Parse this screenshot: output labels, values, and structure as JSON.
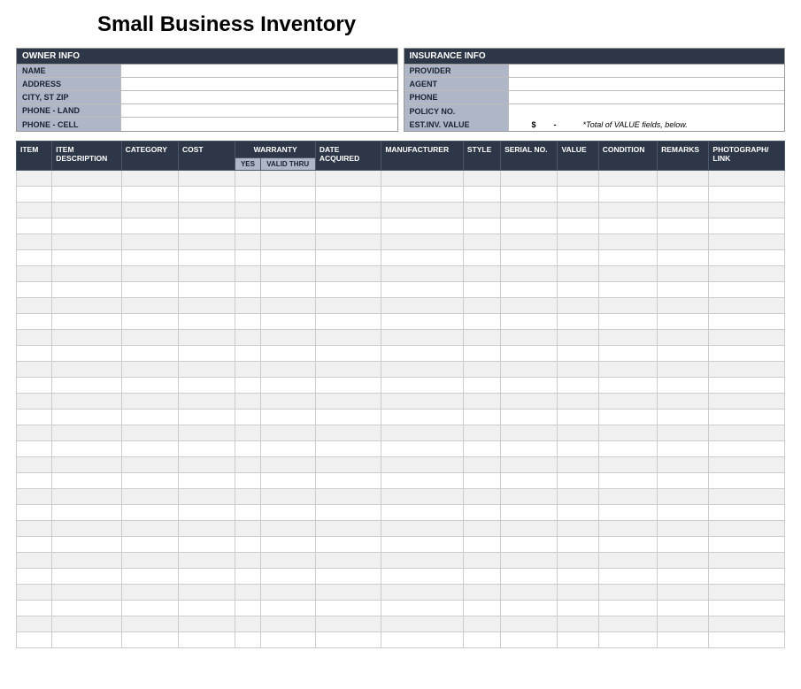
{
  "title": "Small Business Inventory",
  "owner_info": {
    "header": "OWNER INFO",
    "fields": [
      {
        "label": "NAME",
        "value": ""
      },
      {
        "label": "ADDRESS",
        "value": ""
      },
      {
        "label": "CITY, ST ZIP",
        "value": ""
      },
      {
        "label": "PHONE - LAND",
        "value": ""
      },
      {
        "label": "PHONE - CELL",
        "value": ""
      }
    ]
  },
  "insurance_info": {
    "header": "INSURANCE INFO",
    "fields": [
      {
        "label": "PROVIDER",
        "value": ""
      },
      {
        "label": "AGENT",
        "value": ""
      },
      {
        "label": "PHONE",
        "value": ""
      },
      {
        "label": "POLICY NO.",
        "value": ""
      }
    ],
    "est_label": "EST.INV. VALUE",
    "est_currency": "$",
    "est_dash": "-",
    "est_note": "*Total of VALUE fields, below."
  },
  "columns": {
    "item": "ITEM",
    "desc": "ITEM DESCRIPTION",
    "cat": "CATEGORY",
    "cost": "COST",
    "warranty": "WARRANTY",
    "wyes": "YES",
    "wthru": "VALID THRU",
    "date": "DATE ACQUIRED",
    "manu": "MANUFACTURER",
    "style": "STYLE",
    "ser": "SERIAL NO.",
    "val": "VALUE",
    "cond": "CONDITION",
    "rem": "REMARKS",
    "photo": "PHOTOGRAPH/ LINK"
  },
  "rows": 30
}
